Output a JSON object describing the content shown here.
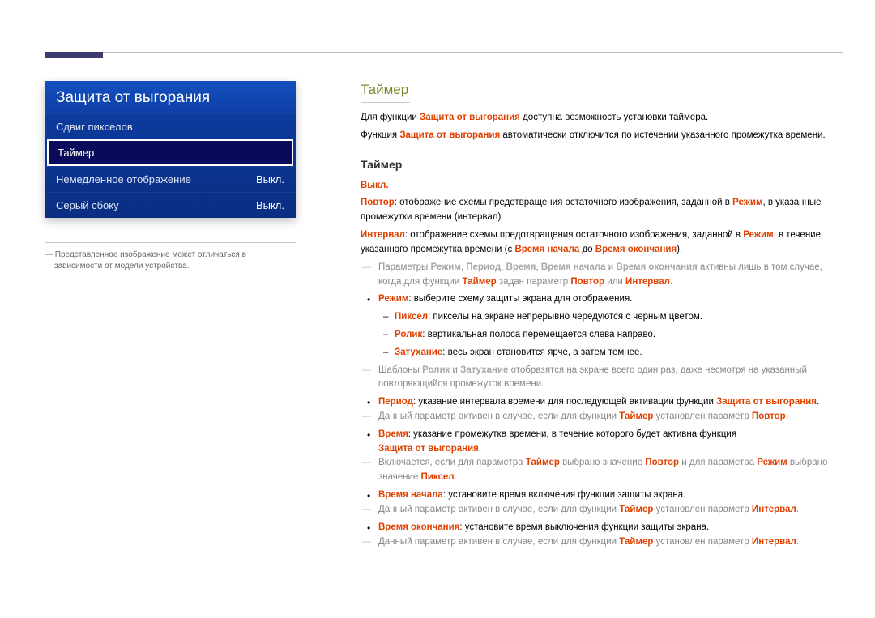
{
  "menu": {
    "title": "Защита от выгорания",
    "items": [
      {
        "label": "Сдвиг пикселов",
        "value": ""
      },
      {
        "label": "Таймер",
        "value": ""
      },
      {
        "label": "Немедленное отображение",
        "value": "Выкл."
      },
      {
        "label": "Серый сбоку",
        "value": "Выкл."
      }
    ]
  },
  "caption": "Представленное изображение может отличаться в зависимости от модели устройства.",
  "section_title": "Таймер",
  "sub_title": "Таймер",
  "t": {
    "for_func": "Для функции ",
    "burn_protect": "Защита от выгорания",
    "timer_opt": " доступна возможность установки таймера.",
    "func": "Функция ",
    "auto_off": " автоматически отключится по истечении указанного промежутка времени.",
    "off": "Выкл.",
    "repeat": "Повтор",
    "repeat_txt_a": ": отображение схемы предотвращения остаточного изображения, заданной в ",
    "mode": "Режим",
    "repeat_txt_b": ", в указанные промежутки времени (интервал).",
    "interval": "Интервал",
    "interval_txt_a": ": отображение схемы предотвращения остаточного изображения, заданной в ",
    "interval_txt_b": ", в течение указанного промежутка времени (с ",
    "start_time": "Время начала",
    "to": " до ",
    "end_time": "Время окончания",
    "close_paren": ").",
    "note1_a": "Параметры ",
    "period": "Период",
    "time": "Время",
    "and": " и ",
    "comma": ", ",
    "note1_b": " активны лишь в том случае, когда для функции ",
    "timer": "Таймер",
    "note1_c": " задан параметр ",
    "or": " или ",
    "dot": ".",
    "mode_desc": ": выберите схему защиты экрана для отображения.",
    "pixel": "Пиксел",
    "pixel_desc": ": пикселы на экране непрерывно чередуются с черным цветом.",
    "roll": "Ролик",
    "roll_desc": ": вертикальная полоса перемещается слева направо.",
    "fade": "Затухание",
    "fade_desc": ": весь экран становится ярче, а затем темнее.",
    "note2_a": "Шаблоны ",
    "note2_b": " отобразятся на экране всего один раз, даже несмотря на указанный повторяющийся промежуток времени.",
    "period_desc_a": ": указание интервала времени для последующей активации функции ",
    "note3_a": "Данный параметр активен в случае, если для функции ",
    "note3_b": " установлен параметр ",
    "time_desc": ": указание промежутка времени, в течение которого будет активна функция ",
    "note4_a": "Включается, если для параметра ",
    "note4_b": " выбрано значение ",
    "note4_c": " и для параметра ",
    "note4_d": " выбрано значение ",
    "start_desc": ": установите время включения функции защиты экрана.",
    "end_desc": ": установите время выключения функции защиты экрана."
  }
}
